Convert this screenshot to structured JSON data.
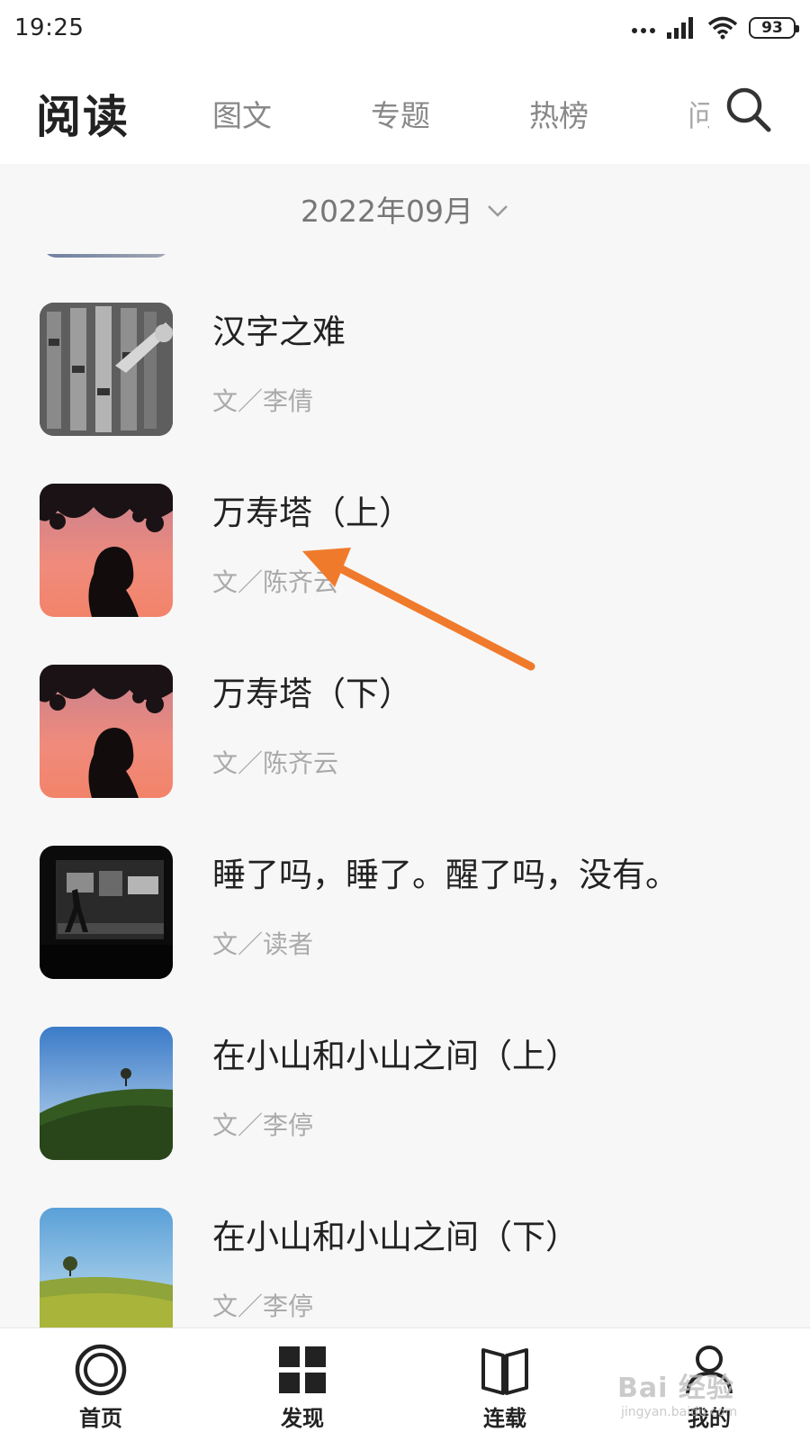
{
  "status_bar": {
    "time": "19:25",
    "battery": "93",
    "icons": [
      "signal-dots-icon",
      "cell-signal-icon",
      "wifi-icon",
      "battery-icon"
    ]
  },
  "header": {
    "title": "阅读",
    "tabs": [
      {
        "label": "图文"
      },
      {
        "label": "专题"
      },
      {
        "label": "热榜"
      },
      {
        "label": "问"
      }
    ],
    "search_icon": "search-icon"
  },
  "filter": {
    "month": "2022年09月",
    "icon": "chevron-down-icon"
  },
  "articles": [
    {
      "title": "汉字之难",
      "author": "文／李倩",
      "thumb_icon": "grayscale-photo"
    },
    {
      "title": "万寿塔（上）",
      "author": "文／陈齐云",
      "thumb_icon": "sunset-silhouette-photo"
    },
    {
      "title": "万寿塔（下）",
      "author": "文／陈齐云",
      "thumb_icon": "sunset-silhouette-photo"
    },
    {
      "title": "睡了吗，睡了。醒了吗，没有。",
      "author": "文／读者",
      "thumb_icon": "night-street-photo"
    },
    {
      "title": "在小山和小山之间（上）",
      "author": "文／李停",
      "thumb_icon": "green-hill-photo"
    },
    {
      "title": "在小山和小山之间（下）",
      "author": "文／李停",
      "thumb_icon": "green-hill-photo"
    }
  ],
  "tab_bar": {
    "items": [
      {
        "label": "首页",
        "icon": "home-ring-icon"
      },
      {
        "label": "发现",
        "icon": "grid-icon"
      },
      {
        "label": "连载",
        "icon": "book-icon"
      },
      {
        "label": "我的",
        "icon": "person-icon"
      }
    ]
  },
  "annotation": {
    "color": "#f07a2c",
    "icon": "arrow-icon"
  },
  "watermark": {
    "text": "Bai 经验",
    "sub": "jingyan.baidu.com"
  }
}
